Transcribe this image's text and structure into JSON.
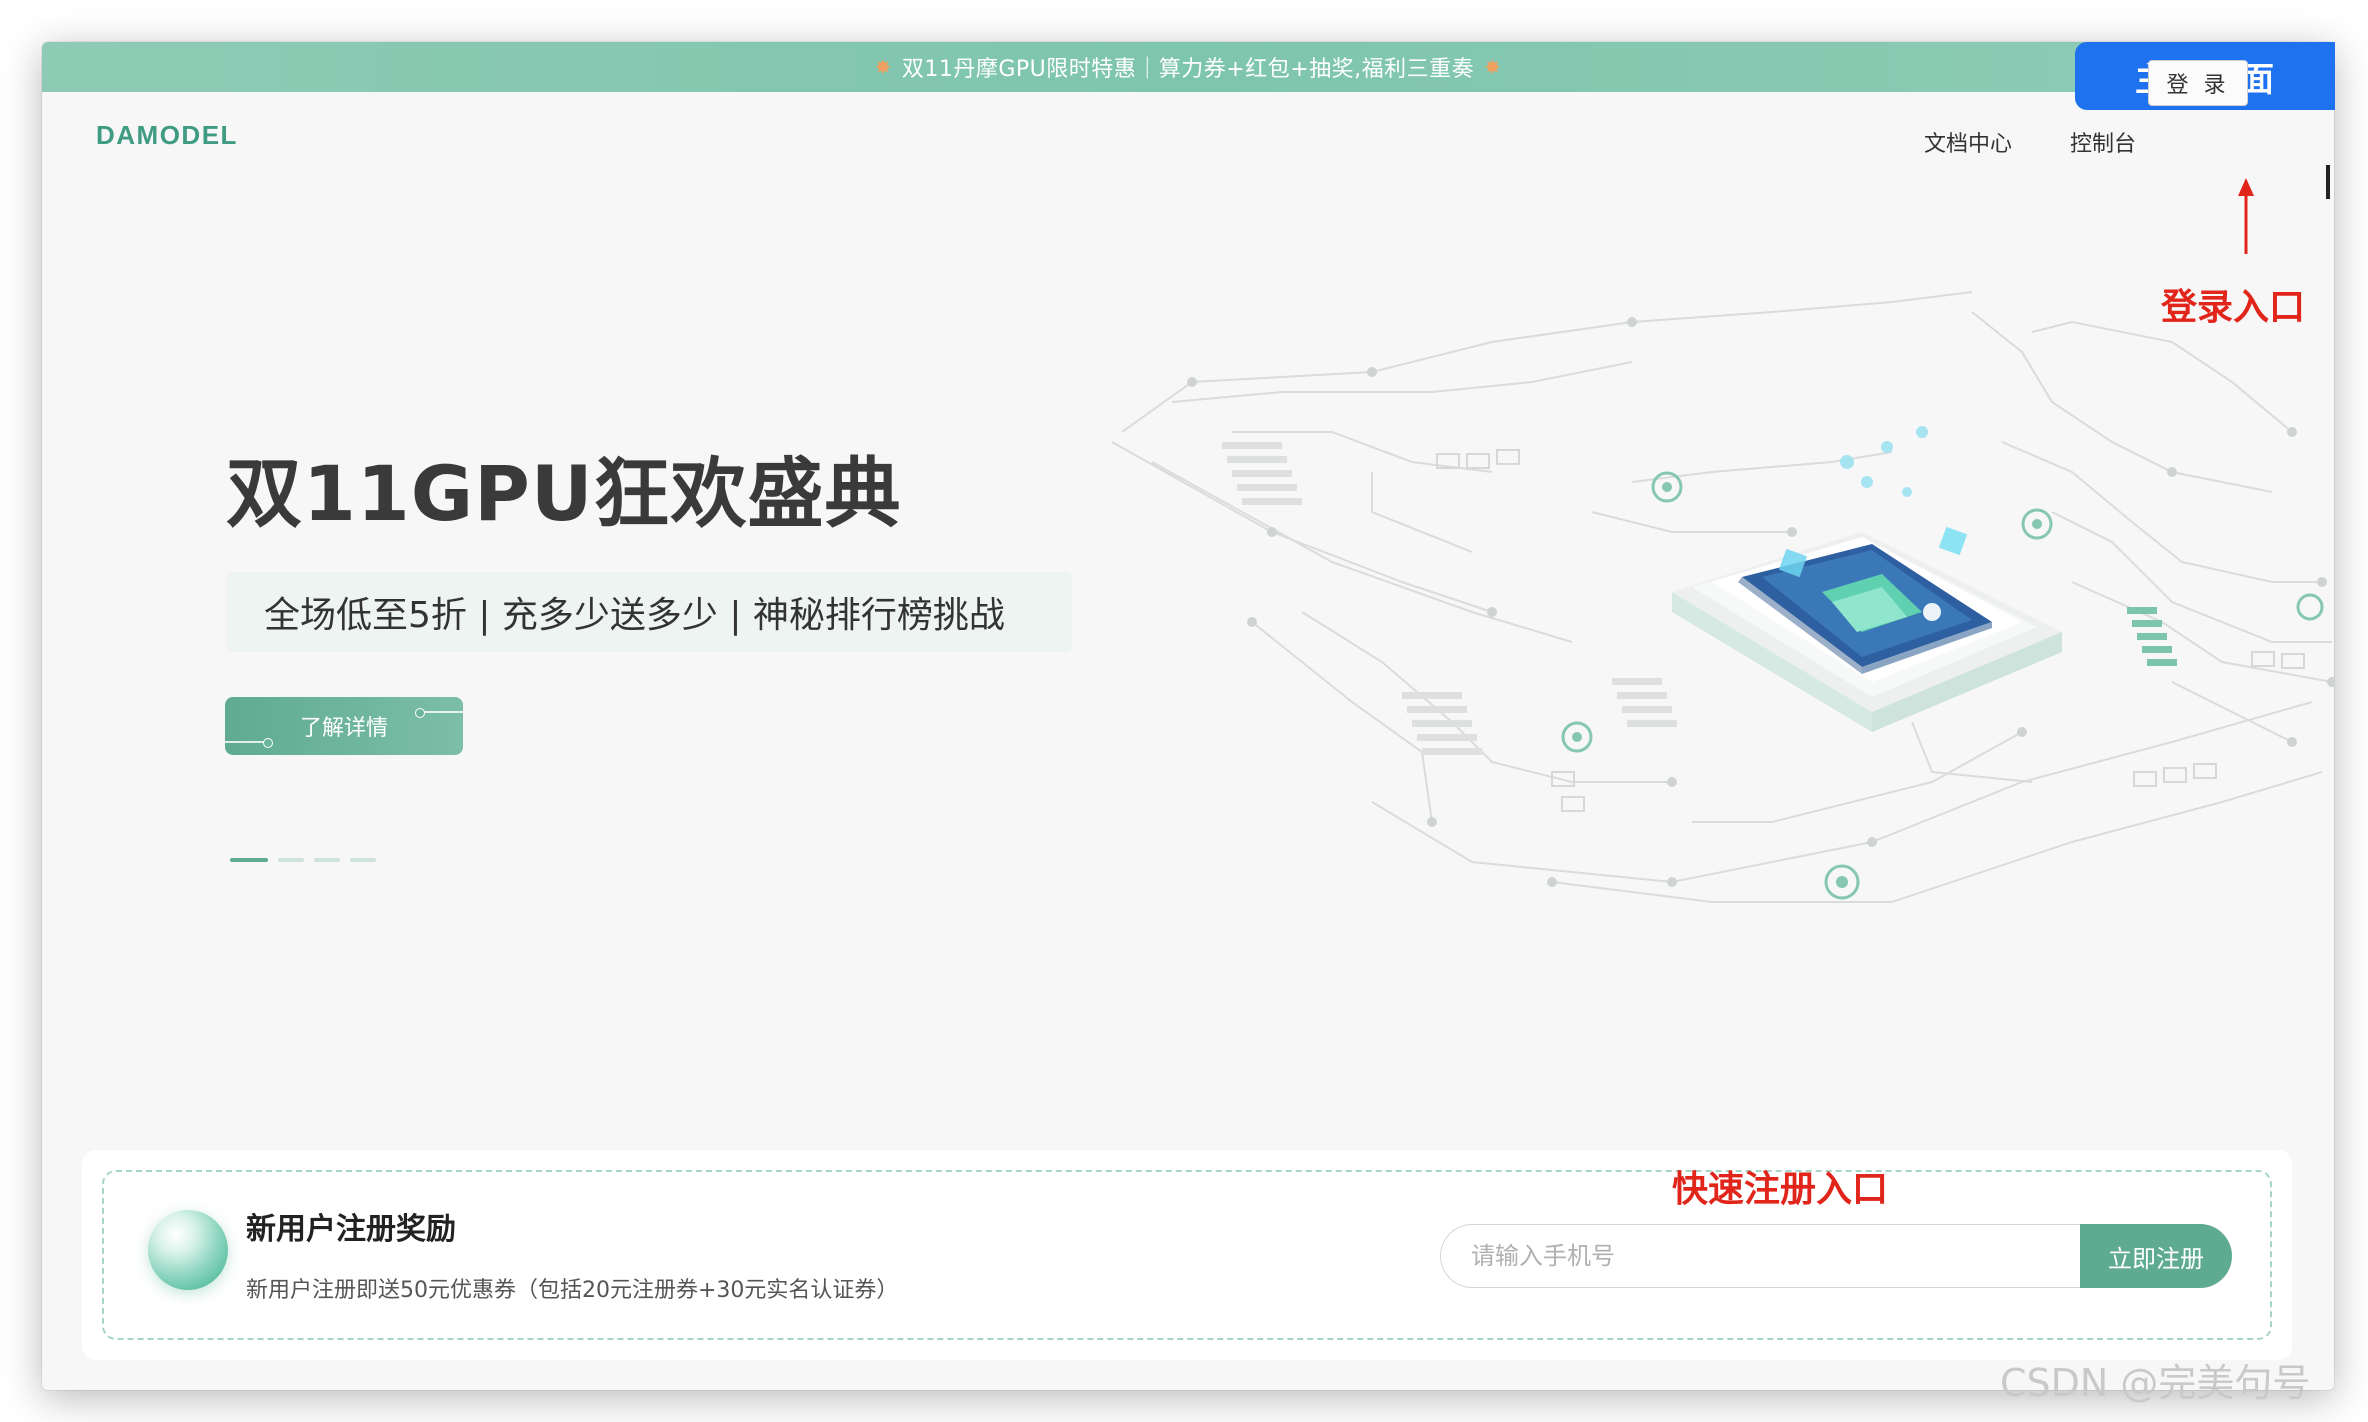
{
  "banner": {
    "text": "双11丹摩GPU限时特惠｜算力券+红包+抽奖,福利三重奏",
    "spark_left": "✸",
    "spark_right": "✸"
  },
  "nav": {
    "logo": "DAMODEL",
    "docs": "文档中心",
    "console": "控制台",
    "login": "登 录"
  },
  "hero": {
    "title": "双11GPU狂欢盛典",
    "subtitle": "全场低至5折 | 充多少送多少 | 神秘排行榜挑战",
    "cta": "了解详情"
  },
  "register": {
    "title": "新用户注册奖励",
    "desc": "新用户注册即送50元优惠券（包括20元注册券+30元实名认证券）",
    "phone_placeholder": "请输入手机号",
    "submit": "立即注册"
  },
  "annotations": {
    "home_tag": "主页页面",
    "login_entry": "登录入口",
    "quick_register": "快速注册入口"
  },
  "watermark": "CSDN @完美句号",
  "colors": {
    "brand": "#5fab92",
    "banner": "#7ec5ad",
    "annotation": "#e1251b",
    "home_tag": "#1e72f0"
  }
}
